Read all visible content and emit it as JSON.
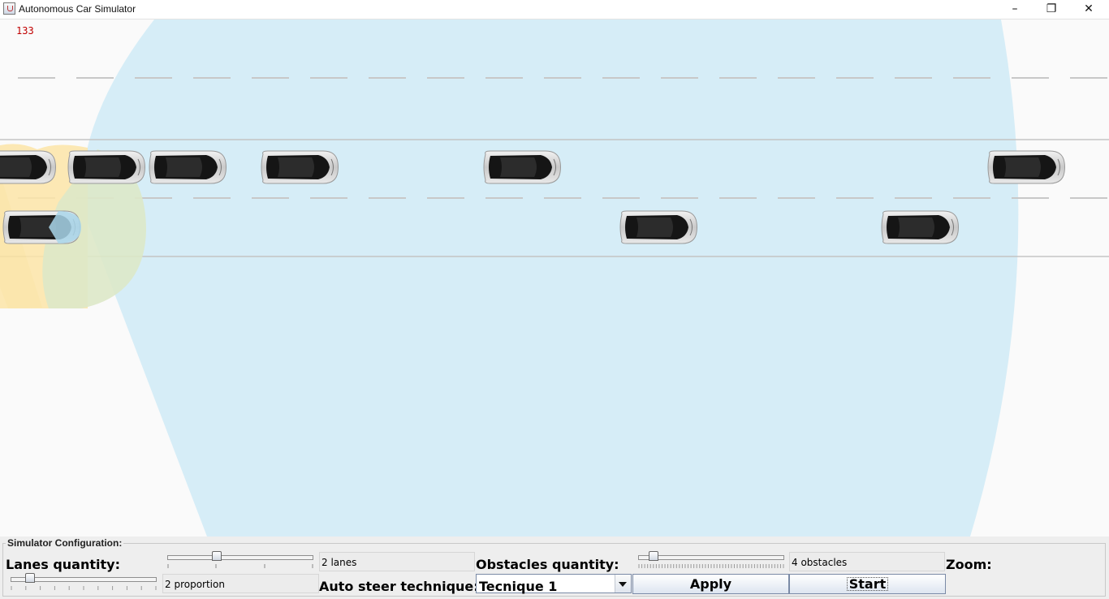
{
  "window": {
    "title": "Autonomous Car Simulator"
  },
  "simulation": {
    "counter": "133"
  },
  "config": {
    "group_title": "Simulator Configuration:",
    "lanes_label": "Lanes quantity:",
    "lanes_value": "2 lanes",
    "lanes_slider_fraction": 0.33,
    "proportion_value": "2 proportion",
    "proportion_slider_fraction": 0.11,
    "obstacles_label": "Obstacles quantity:",
    "obstacles_value": "4 obstacles",
    "obstacles_slider_fraction": 0.08,
    "steer_label": "Auto steer technique:",
    "steer_selected": "Tecnique 1",
    "apply_label": "Apply",
    "start_label": "Start",
    "zoom_label": "Zoom:"
  },
  "colors": {
    "road_background": "#fafafa",
    "sensor_blue": "#d6edf7",
    "sensor_yellow": "#fde6a8",
    "sensor_green": "#dde8c8",
    "counter_red": "#c00000"
  },
  "icons": [
    "java-app-icon",
    "minimize-icon",
    "maximize-icon",
    "close-icon",
    "chevron-down-icon",
    "car-icon"
  ]
}
